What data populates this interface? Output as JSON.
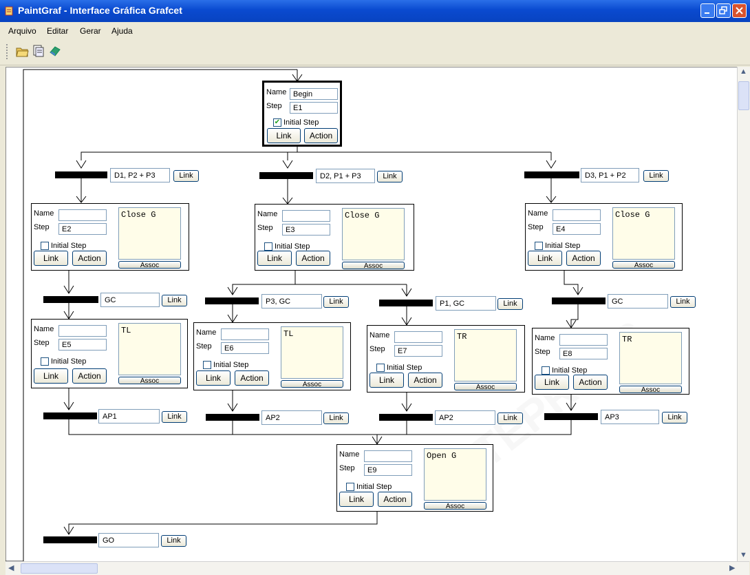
{
  "window": {
    "title": "PaintGraf - Interface Gráfica Grafcet"
  },
  "menu": [
    "Arquivo",
    "Editar",
    "Gerar",
    "Ajuda"
  ],
  "toolbar": [
    "open-icon",
    "save-icon",
    "generate-icon"
  ],
  "labels": {
    "name": "Name",
    "step": "Step",
    "initial": "Initial Step",
    "link": "Link",
    "action": "Action",
    "assoc": "Assoc"
  },
  "steps": [
    {
      "name": "Begin",
      "step": "E1",
      "initial": true,
      "action": ""
    },
    {
      "name": "",
      "step": "E2",
      "initial": false,
      "action": "Close G"
    },
    {
      "name": "",
      "step": "E3",
      "initial": false,
      "action": "Close G"
    },
    {
      "name": "",
      "step": "E4",
      "initial": false,
      "action": "Close G"
    },
    {
      "name": "",
      "step": "E5",
      "initial": false,
      "action": "TL"
    },
    {
      "name": "",
      "step": "E6",
      "initial": false,
      "action": "TL"
    },
    {
      "name": "",
      "step": "E7",
      "initial": false,
      "action": "TR"
    },
    {
      "name": "",
      "step": "E8",
      "initial": false,
      "action": "TR"
    },
    {
      "name": "",
      "step": "E9",
      "initial": false,
      "action": "Open G"
    }
  ],
  "transitions": [
    "D1, P2 + P3",
    "D2, P1 + P3",
    "D3, P1 + P2",
    "GC",
    "P3, GC",
    "P1, GC",
    "GC",
    "AP1",
    "AP2",
    "AP2",
    "AP3",
    "GO"
  ]
}
